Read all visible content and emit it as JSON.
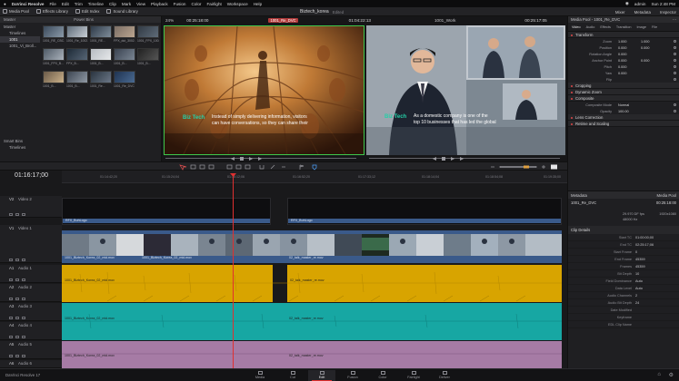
{
  "menubar": {
    "app": "DaVinci Resolve",
    "items": [
      "File",
      "Edit",
      "Trim",
      "Timeline",
      "Clip",
      "Mark",
      "View",
      "Playback",
      "Fusion",
      "Color",
      "Fairlight",
      "Workspace",
      "Help"
    ],
    "right": [
      "admin",
      "Sun 2:48 PM"
    ]
  },
  "toolbar": {
    "left": [
      "Media Pool",
      "Effects Library",
      "Edit Index",
      "Sound Library"
    ],
    "project": "Biztech_korea",
    "project_state": "Edited",
    "right": [
      "Mixer",
      "Metadata",
      "Inspector"
    ]
  },
  "mediapool": {
    "header": [
      "Master",
      "Power Bins"
    ],
    "bins": [
      {
        "label": "Master",
        "sel": false,
        "sub": false
      },
      {
        "label": "Timelines",
        "sel": false,
        "sub": true
      },
      {
        "label": "1001",
        "sel": true,
        "sub": true
      },
      {
        "label": "1001_Vi_Broll...",
        "sel": false,
        "sub": true
      }
    ],
    "smartbins": [
      "Smart Bins",
      "Timelines"
    ],
    "thumbs": [
      {
        "cap": "1001_RE_CBC...",
        "c1": "#3b4a5c",
        "c2": "#8b9aa8"
      },
      {
        "cap": "1001_Re_1002...",
        "c1": "#606d7a",
        "c2": "#c7cdd4"
      },
      {
        "cap": "1001_RE...",
        "c1": "#2e3a48",
        "c2": "#7e8c99"
      },
      {
        "cap": "FPX_dut_3002...",
        "c1": "#7c6f66",
        "c2": "#bba58f"
      },
      {
        "cap": "1001_FPX_1002...",
        "c1": "#323b45",
        "c2": "#5f6b78"
      },
      {
        "cap": "1001_FPX_B...",
        "c1": "#4f5a66",
        "c2": "#aab2bb"
      },
      {
        "cap": "FPX_B...",
        "c1": "#1e2b38",
        "c2": "#576575"
      },
      {
        "cap": "1001_B...",
        "c1": "#b7bcc2",
        "c2": "#e6e8ea"
      },
      {
        "cap": "1001_B...",
        "c1": "#3a4350",
        "c2": "#7a8593"
      },
      {
        "cap": "1001_B...",
        "c1": "#222",
        "c2": "#555"
      },
      {
        "cap": "1001_B...",
        "c1": "#6a5a48",
        "c2": "#c9b08a"
      },
      {
        "cap": "1001_B...",
        "c1": "#3d4652",
        "c2": "#9099a4"
      },
      {
        "cap": "1001_Re...",
        "c1": "#2a3440",
        "c2": "#6b7786"
      },
      {
        "cap": "1001_Re_DVC",
        "c1": "#1f3350",
        "c2": "#4a6a92"
      }
    ]
  },
  "source": {
    "zoom": "24%",
    "timecode": "00:25:18:00",
    "clip": "1001_Re_DVC",
    "dur": "01:04:22:13"
  },
  "program": {
    "timeline": "1001_Work",
    "zoom": "22%",
    "timecode": "00:25:17:05"
  },
  "subtitle_left": {
    "logo": "Biz Tech",
    "line1": "Instead of simply delivering information, visitors",
    "line2": "can have conversations, so they can share their"
  },
  "subtitle_right": {
    "logo": "Biz Tech",
    "line1": "As a domestic company is one of the",
    "line2": "top 10 businesses that has led the global"
  },
  "timeline": {
    "timecode": "01:16:17;00",
    "ticks": [
      "01:14:42;20",
      "01:15:24;04",
      "01:16:12;06",
      "01:16:52;20",
      "01:17:33;12",
      "01:18:14;04",
      "01:18:54;08",
      "01:19:35;00"
    ],
    "tracks": [
      {
        "id": "V2",
        "name": "Video 2"
      },
      {
        "id": "V1",
        "name": "Video 1"
      },
      {
        "id": "A1",
        "name": "Audio 1"
      },
      {
        "id": "A2",
        "name": "Audio 2"
      },
      {
        "id": "A3",
        "name": "Audio 3"
      },
      {
        "id": "A4",
        "name": "Audio 4"
      },
      {
        "id": "A5",
        "name": "Audio 5"
      },
      {
        "id": "A6",
        "name": "Audio 6"
      }
    ],
    "clips": {
      "v2a": "RFX_BuhLogo",
      "v2b": "RFX_BuhLogo",
      "v1a": "1001_Biztech_Korea_02_mid.mov",
      "v1b": "1001_Biztech_Korea_02_mid.mov",
      "v1c": "02_talk_master_re.mov",
      "a1a": "1001_Biztech_Korea_02_mid.mov",
      "a1b": "02_talk_master_re.mov",
      "a3a": "1001_Biztech_Korea_02_mid.mov",
      "a3b": "02_talk_master_re.mov",
      "a5a": "1001_Biztech_Korea_02_mid.mov",
      "a5b": "02_talk_master_re.mov"
    }
  },
  "inspector": {
    "header": "Media Pool - 1001_Re_DVC",
    "tabs": [
      "Video",
      "Audio",
      "Effects",
      "Transition",
      "Image",
      "File"
    ],
    "sections": [
      "Transform",
      "Cropping",
      "Dynamic Zoom",
      "Composite",
      "Lens Correction",
      "Retime and Scaling"
    ],
    "transform": [
      {
        "k": "Zoom",
        "x": "1.000",
        "y": "1.000"
      },
      {
        "k": "Position",
        "x": "0.000",
        "y": "0.000"
      },
      {
        "k": "Rotation Angle",
        "x": "0.000",
        "y": ""
      },
      {
        "k": "Anchor Point",
        "x": "0.000",
        "y": "0.000"
      },
      {
        "k": "Pitch",
        "x": "0.000",
        "y": ""
      },
      {
        "k": "Yaw",
        "x": "0.000",
        "y": ""
      },
      {
        "k": "Flip",
        "x": "",
        "y": ""
      }
    ],
    "composite": [
      {
        "k": "Composite Mode",
        "x": "Normal",
        "y": ""
      },
      {
        "k": "Opacity",
        "x": "100.00",
        "y": ""
      }
    ]
  },
  "metadata": {
    "header": "Metadata",
    "right": "Media Pool",
    "clip": "1001_Re_DVC",
    "clip_tc": "00:25:18:00",
    "fps": "29.970 DF fps",
    "hz": "48000 Hz",
    "res": "1920x1080",
    "details": "Clip Details",
    "rows": [
      {
        "k": "Start TC",
        "v": "01:00:00;00"
      },
      {
        "k": "End TC",
        "v": "02:25:17;06"
      },
      {
        "k": "Start Frame",
        "v": "0"
      },
      {
        "k": "End Frame",
        "v": "45359"
      },
      {
        "k": "Frames",
        "v": "45359"
      },
      {
        "k": "Bit Depth",
        "v": "10"
      },
      {
        "k": "Field Dominance",
        "v": "Auto"
      },
      {
        "k": "Data Level",
        "v": "Auto"
      },
      {
        "k": "Audio Channels",
        "v": "2"
      },
      {
        "k": "Audio Bit Depth",
        "v": "24"
      },
      {
        "k": "Date Modified",
        "v": ""
      },
      {
        "k": "Keyframe",
        "v": ""
      },
      {
        "k": "EDL Clip Name",
        "v": ""
      }
    ]
  },
  "pagebar": {
    "brand": "DaVinci Resolve 17",
    "pages": [
      "Media",
      "Cut",
      "Edit",
      "Fusion",
      "Color",
      "Fairlight",
      "Deliver"
    ],
    "active": "Edit"
  }
}
